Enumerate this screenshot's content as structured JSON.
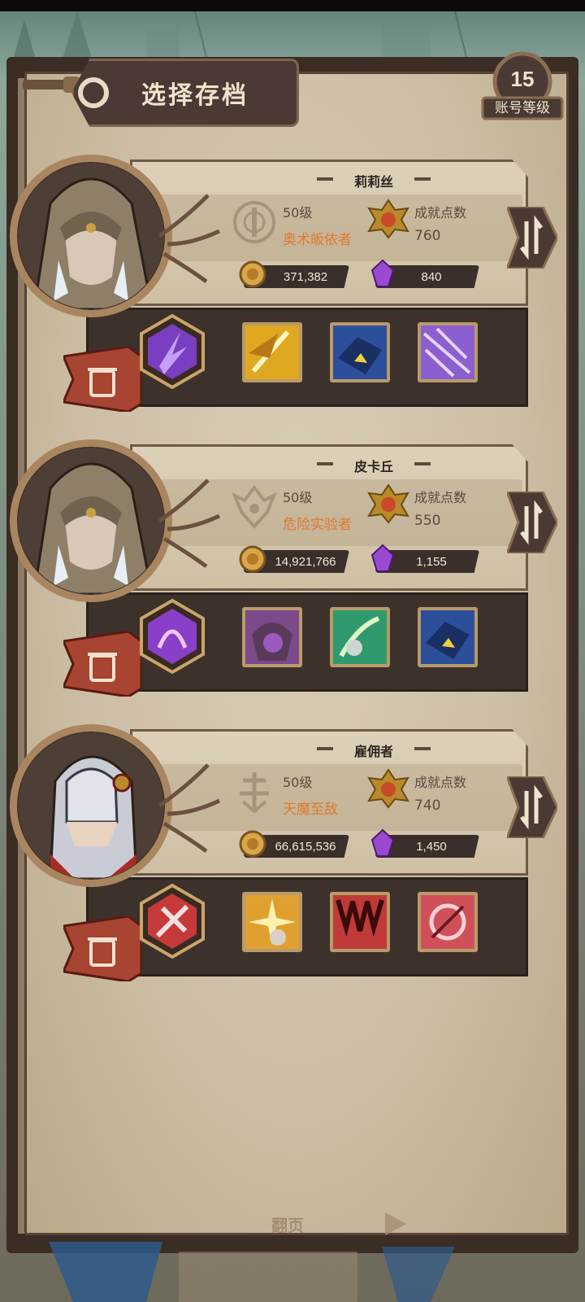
{
  "header": {
    "title": "选择存档",
    "account_level": "15",
    "account_level_label": "账号等级"
  },
  "slots": [
    {
      "name": "莉莉丝",
      "level": "50级",
      "class_name": "奥术皈依者",
      "achievement_label": "成就点数",
      "achievement_points": "760",
      "gold": "371,382",
      "gems": "840",
      "skill_colors": [
        "#7a3fc0",
        "#e0a820",
        "#2c4f9c",
        "#8c5fd0"
      ]
    },
    {
      "name": "皮卡丘",
      "level": "50级",
      "class_name": "危险实验者",
      "achievement_label": "成就点数",
      "achievement_points": "550",
      "gold": "14,921,766",
      "gems": "1,155",
      "skill_colors": [
        "#8a3fc8",
        "#7a4a8a",
        "#2f9a6e",
        "#2c4f9c"
      ]
    },
    {
      "name": "雇佣者",
      "level": "50级",
      "class_name": "天魔至敌",
      "achievement_label": "成就点数",
      "achievement_points": "740",
      "gold": "66,615,536",
      "gems": "1,450",
      "skill_colors": [
        "#c63a3a",
        "#e0a030",
        "#c03a3a",
        "#d0505a"
      ]
    }
  ],
  "footer": {
    "flip_label": "翻页"
  },
  "colors": {
    "accent_orange": "#e07a2e",
    "panel_dark": "#3d312b",
    "parchment": "#d9ccb6"
  }
}
